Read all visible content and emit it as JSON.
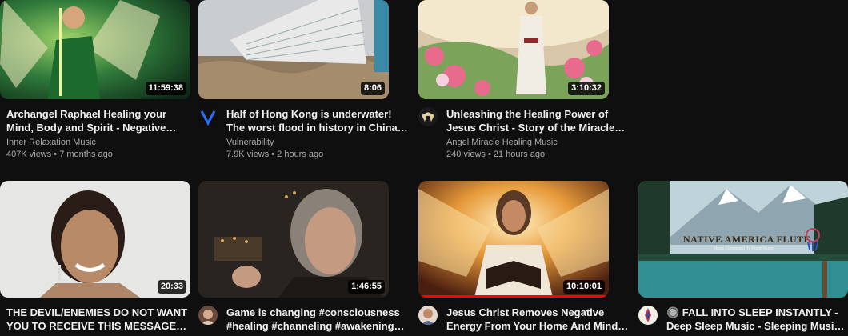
{
  "videos": [
    {
      "title": "Archangel Raphael Healing your Mind, Body and Spirit - Negative Emotions…",
      "channel": "Inner Relaxation Music",
      "stats": "407K views • 7 months ago",
      "duration": "11:59:38",
      "thumb_icon": "archangel-thumbnail",
      "avatar_icon": "none"
    },
    {
      "title": "Half of Hong Kong is underwater! The worst flood in history in China after…",
      "channel": "Vulnerability",
      "stats": "7.9K views • 2 hours ago",
      "duration": "8:06",
      "thumb_icon": "flood-building-thumbnail",
      "avatar_icon": "v-logo-avatar"
    },
    {
      "title": "Unleashing the Healing Power of Jesus Christ - Story of the Miracles of Jesus…",
      "channel": "Angel Miracle Healing Music",
      "stats": "240 views • 21 hours ago",
      "duration": "3:10:32",
      "thumb_icon": "jesus-flowers-thumbnail",
      "avatar_icon": "angel-logo-avatar"
    },
    {
      "title": "THE DEVIL/ENEMIES DO NOT WANT YOU TO RECEIVE THIS MESSAGE ‼…",
      "channel": "",
      "stats": "",
      "duration": "20:33",
      "thumb_icon": "woman-smiling-thumbnail",
      "avatar_icon": "none"
    },
    {
      "title": "Game is changing #consciousness #healing #channeling #awakening…",
      "channel": "",
      "stats": "",
      "duration": "1:46:55",
      "thumb_icon": "woman-speaking-thumbnail",
      "avatar_icon": "woman-avatar"
    },
    {
      "title": "Jesus Christ Removes Negative Energy From Your Home And Mind Music heal…",
      "channel": "",
      "stats": "",
      "duration": "10:10:01",
      "thumb_icon": "jesus-book-thumbnail",
      "avatar_icon": "woman-avatar-2",
      "watched_fraction": 1.0
    },
    {
      "title": "🔘 FALL INTO SLEEP INSTANTLY - Deep Sleep Music - Sleeping Music for Deep…",
      "channel": "",
      "stats": "",
      "duration": "",
      "thumb_icon": "mountain-lake-thumbnail",
      "thumb_text": "NATIVE AMERICA FLUTE",
      "thumb_subtext": "Music Composed By Flutist Music",
      "avatar_icon": "feather-avatar"
    }
  ],
  "colors": {
    "background": "#0f0f0f",
    "title": "#f1f1f1",
    "meta": "#aaaaaa",
    "progress": "#ff0000"
  }
}
